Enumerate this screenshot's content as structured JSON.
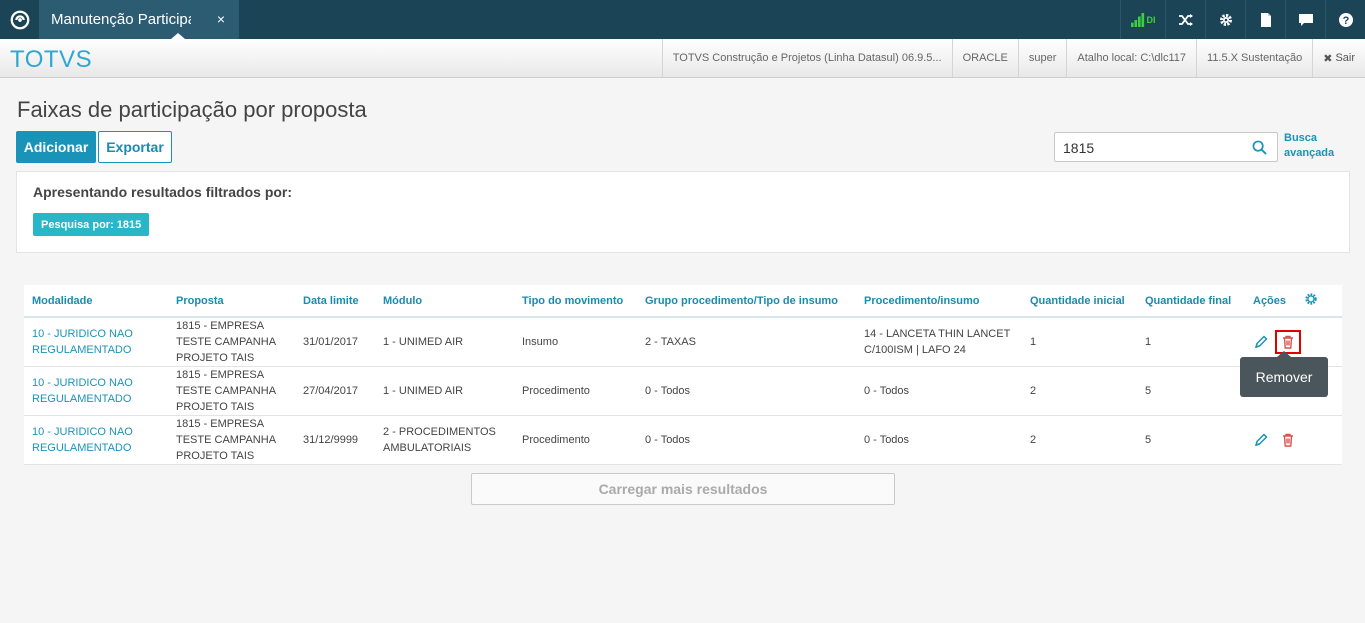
{
  "app": {
    "tab_label": "Manutenção Participaç",
    "tab_close": "×",
    "brand": "TOTVS",
    "signal_label": "DI"
  },
  "infobar": {
    "product": "TOTVS Construção e Projetos (Linha Datasul) 06.9.5...",
    "database": "ORACLE",
    "user": "super",
    "shortcut": "Atalho local: C:\\dlc117",
    "version": "11.5.X Sustentação",
    "logout": "Sair"
  },
  "page": {
    "title": "Faixas de participação por proposta",
    "add_button": "Adicionar",
    "export_button": "Exportar",
    "search_value": "1815",
    "advanced_search": "Busca avançada"
  },
  "filter": {
    "title": "Apresentando resultados filtrados por:",
    "tag": "Pesquisa por: 1815"
  },
  "table": {
    "headers": [
      "Modalidade",
      "Proposta",
      "Data limite",
      "Módulo",
      "Tipo do movimento",
      "Grupo procedimento/Tipo de insumo",
      "Procedimento/insumo",
      "Quantidade inicial",
      "Quantidade final",
      "Ações"
    ],
    "rows": [
      {
        "modalidade": "10 - JURIDICO NAO REGULAMENTADO",
        "proposta": "1815 - EMPRESA TESTE CAMPANHA PROJETO TAIS",
        "data_limite": "31/01/2017",
        "modulo": "1 - UNIMED AIR",
        "tipo_movimento": "Insumo",
        "grupo": "2 - TAXAS",
        "procedimento": "14 - LANCETA THIN LANCET C/100ISM | LAFO 24",
        "qtd_inicial": "1",
        "qtd_final": "1"
      },
      {
        "modalidade": "10 - JURIDICO NAO REGULAMENTADO",
        "proposta": "1815 - EMPRESA TESTE CAMPANHA PROJETO TAIS",
        "data_limite": "27/04/2017",
        "modulo": "1 - UNIMED AIR",
        "tipo_movimento": "Procedimento",
        "grupo": "0 - Todos",
        "procedimento": "0 - Todos",
        "qtd_inicial": "2",
        "qtd_final": "5"
      },
      {
        "modalidade": "10 - JURIDICO NAO REGULAMENTADO",
        "proposta": "1815 - EMPRESA TESTE CAMPANHA PROJETO TAIS",
        "data_limite": "31/12/9999",
        "modulo": "2 - PROCEDIMENTOS AMBULATORIAIS",
        "tipo_movimento": "Procedimento",
        "grupo": "0 - Todos",
        "procedimento": "0 - Todos",
        "qtd_inicial": "2",
        "qtd_final": "5"
      }
    ]
  },
  "tooltip": "Remover",
  "load_more": "Carregar mais resultados",
  "colors": {
    "topbar": "#1b4456",
    "accent": "#1a93b8",
    "brand": "#2fa7d2",
    "tag": "#29b6c8",
    "delete": "#d9534f",
    "highlight": "#e00000",
    "signal": "#3ecf3e"
  }
}
